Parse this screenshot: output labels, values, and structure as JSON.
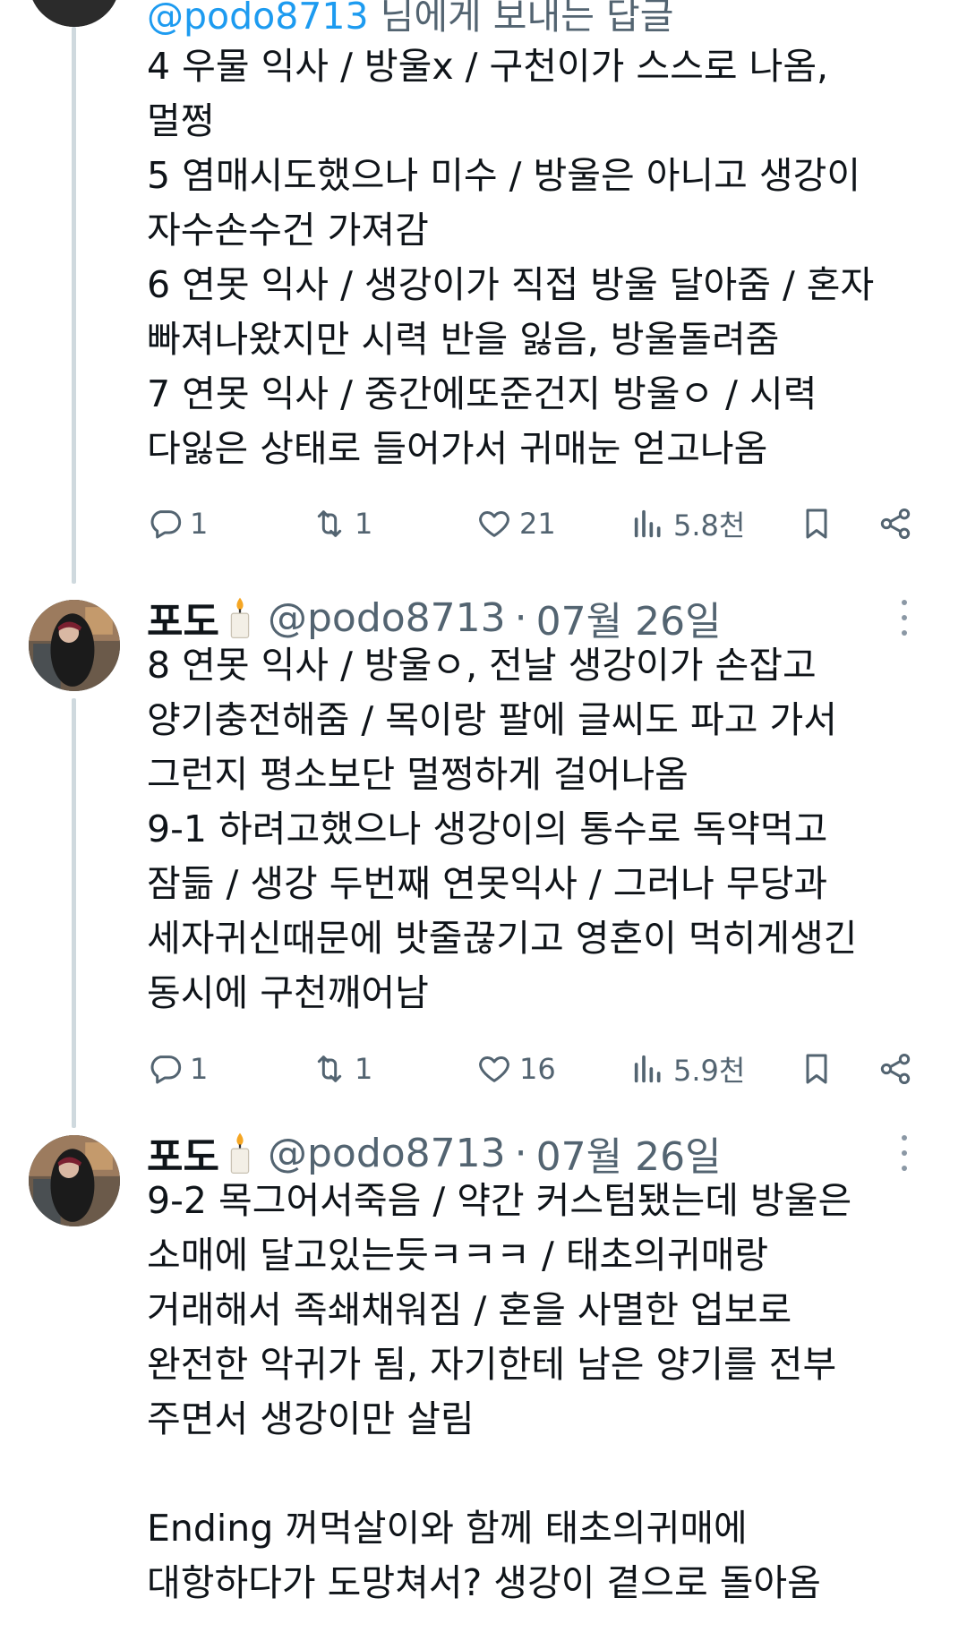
{
  "top_fragment": {
    "handle": "@podo8713",
    "text": " 님에게 보내는 답글"
  },
  "tweets": [
    {
      "body": "4 우물 익사 / 방울x / 구천이가 스스로 나옴,\n멀쩡\n5 염매시도했으나 미수 / 방울은 아니고 생강이\n자수손수건 가져감\n6 연못 익사 / 생강이가 직접 방울 달아줌 / 혼자\n빠져나왔지만 시력 반을 잃음, 방울돌려줌\n7 연못 익사 / 중간에또준건지 방울ㅇ / 시력\n다잃은 상태로 들어가서 귀매눈 얻고나옴",
      "replies": "1",
      "retweets": "1",
      "likes": "21",
      "views": "5.8천"
    },
    {
      "name": "포도",
      "handle": "@podo8713",
      "dot": "·",
      "date": "07월 26일",
      "body": "8 연못 익사 / 방울ㅇ, 전날 생강이가 손잡고\n양기충전해줌 / 목이랑 팔에 글씨도 파고 가서\n그런지 평소보단 멀쩡하게 걸어나옴\n9-1 하려고했으나 생강이의 통수로 독약먹고\n잠듦 / 생강 두번째 연못익사 / 그러나 무당과\n세자귀신때문에 밧줄끊기고 영혼이 먹히게생긴\n동시에 구천깨어남",
      "replies": "1",
      "retweets": "1",
      "likes": "16",
      "views": "5.9천"
    },
    {
      "name": "포도",
      "handle": "@podo8713",
      "dot": "·",
      "date": "07월 26일",
      "body": "9-2 목그어서죽음 / 약간 커스텀됐는데 방울은\n소매에 달고있는듯ㅋㅋㅋ / 태초의귀매랑\n거래해서 족쇄채워짐 / 혼을 사멸한 업보로\n완전한 악귀가 됨, 자기한테 남은 양기를 전부\n주면서 생강이만 살림\n\nEnding 꺼먹살이와 함께 태초의귀매에\n대항하다가 도망쳐서? 생강이 곁으로 돌아옴"
    }
  ],
  "icons": {
    "reply": "reply-icon",
    "retweet": "retweet-icon",
    "like": "heart-icon",
    "views": "views-chart-icon",
    "bookmark": "bookmark-icon",
    "share": "share-icon",
    "more": "more-dots-icon",
    "candle": "candle-emoji-icon"
  },
  "colors": {
    "text": "#0f1419",
    "secondary": "#536471",
    "thread_line": "#cfd9de",
    "link": "#1d9bf0"
  }
}
